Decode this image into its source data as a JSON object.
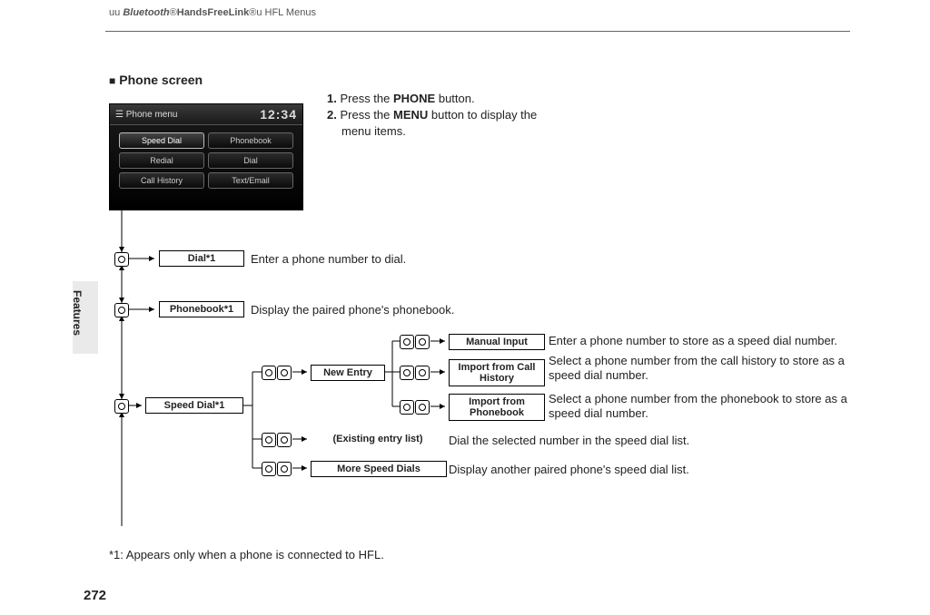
{
  "header": {
    "prefix": "uu",
    "brand": "Bluetooth",
    "reg1": "®",
    "product": "HandsFreeLink",
    "reg2": "®",
    "suffix": "u HFL Menus"
  },
  "side_label": "Features",
  "section_title": "Phone screen",
  "instructions": {
    "step1_num": "1.",
    "step1a": "Press the ",
    "step1b": "PHONE",
    "step1c": " button.",
    "step2_num": "2.",
    "step2a": "Press the ",
    "step2b": "MENU",
    "step2c": " button to display the",
    "step2d": "menu items."
  },
  "screenshot": {
    "title": "Phone menu",
    "clock": "12:34",
    "buttons": [
      "Speed Dial",
      "Phonebook",
      "Redial",
      "Dial",
      "Call History",
      "Text/Email"
    ]
  },
  "nodes": {
    "dial": "Dial*1",
    "phonebook": "Phonebook*1",
    "speed_dial": "Speed Dial*1",
    "new_entry": "New Entry",
    "manual_input": "Manual Input",
    "import_call": "Import from Call History",
    "import_pb": "Import from Phonebook",
    "existing": "(Existing entry list)",
    "more": "More Speed Dials"
  },
  "descs": {
    "dial": "Enter a phone number to dial.",
    "phonebook": "Display the paired phone's phonebook.",
    "manual_input": "Enter a phone number to store as a speed dial number.",
    "import_call": "Select a phone number from the call history to store as a speed dial number.",
    "import_pb": "Select a phone number from the phonebook to store as a speed dial number.",
    "existing": "Dial the selected number in the speed dial list.",
    "more": "Display another paired phone's speed dial list."
  },
  "footnote": "*1: Appears only when a phone is connected to HFL.",
  "page_number": "272"
}
